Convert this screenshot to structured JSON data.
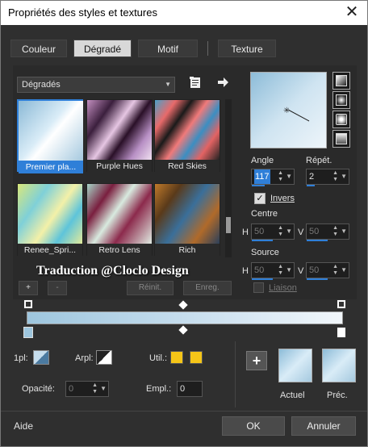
{
  "window": {
    "title": "Propriétés des styles et textures",
    "close_glyph": "✕"
  },
  "tabs": [
    {
      "label": "Couleur",
      "active": false
    },
    {
      "label": "Dégradé",
      "active": true
    },
    {
      "label": "Motif",
      "active": false
    },
    {
      "label": "Texture",
      "active": false
    }
  ],
  "category": {
    "selected": "Dégradés"
  },
  "gradients": [
    {
      "name": "Premier pla...",
      "selected": true
    },
    {
      "name": "Purple Hues"
    },
    {
      "name": "Red Skies"
    },
    {
      "name": "Renee_Spri..."
    },
    {
      "name": "Retro Lens"
    },
    {
      "name": "Rich"
    }
  ],
  "list_buttons": {
    "add": "+",
    "remove": "-",
    "reset": "Réinit.",
    "save": "Enreg."
  },
  "watermark": "Traduction @Cloclo Design",
  "style_icons": [
    "linear-style-icon",
    "rectangular-style-icon",
    "sunburst-style-icon",
    "radial-style-icon"
  ],
  "angle": {
    "label": "Angle",
    "value": "117"
  },
  "repeat": {
    "label": "Répét.",
    "value": "2"
  },
  "invert": {
    "label": "Invers",
    "checked": true
  },
  "center": {
    "label": "Centre",
    "h_label": "H",
    "h_value": "50",
    "v_label": "V",
    "v_value": "50"
  },
  "source": {
    "label": "Source",
    "h_label": "H",
    "h_value": "50",
    "v_label": "V",
    "v_value": "50"
  },
  "link": {
    "label": "Liaison",
    "checked": false
  },
  "colors": {
    "accent": "#2f7fd8",
    "swatch_yellow": "#f5c518",
    "gradient_start": "#9ec6de",
    "gradient_end": "#f2f7fb"
  },
  "bottom": {
    "first_plan_label": "1pl:",
    "back_plan_label": "Arpl:",
    "util_label": "Util.:",
    "opacity_label": "Opacité:",
    "opacity_value": "0",
    "empl_label": "Empl.:",
    "empl_value": "0",
    "add_symbol": "+",
    "current_label": "Actuel",
    "previous_label": "Préc."
  },
  "footer": {
    "help": "Aide",
    "ok": "OK",
    "cancel": "Annuler"
  }
}
